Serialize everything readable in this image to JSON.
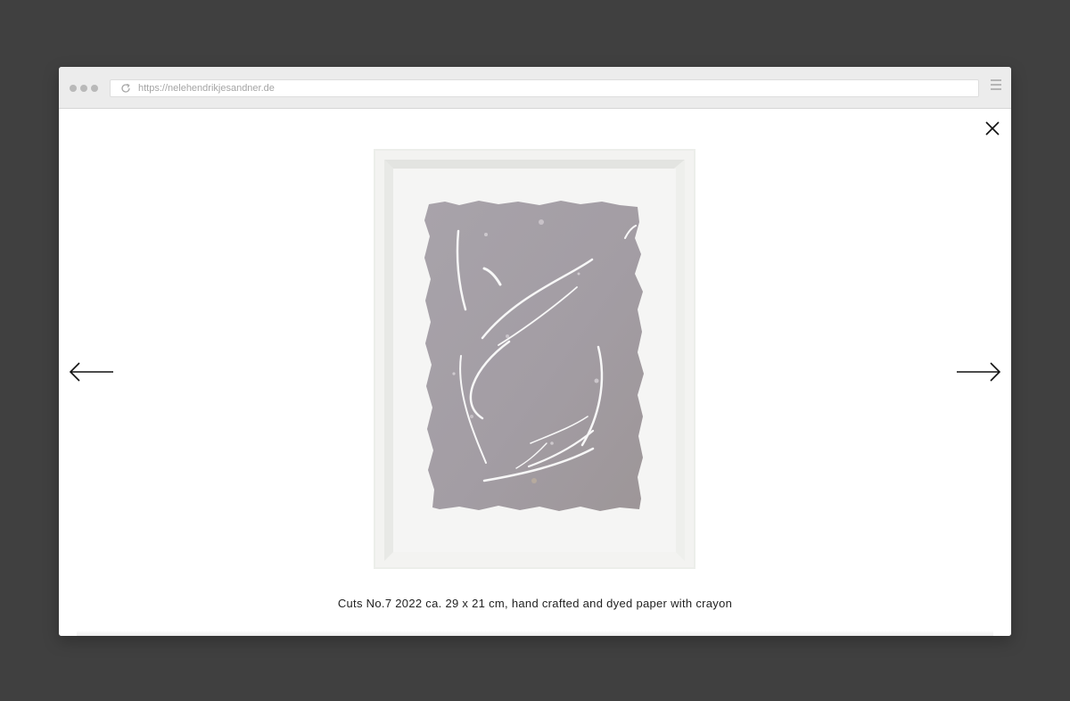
{
  "browser": {
    "url": "https://nelehendrikjesandner.de",
    "window_controls": [
      "dot",
      "dot",
      "dot"
    ],
    "icons": {
      "reload": "reload-icon",
      "menu": "hamburger-menu-icon"
    }
  },
  "lightbox": {
    "caption": "Cuts No.7 2022 ca. 29 x 21 cm, hand crafted and dyed paper with crayon",
    "icons": {
      "close": "close-icon",
      "previous": "arrow-left-icon",
      "next": "arrow-right-icon"
    },
    "colors": {
      "background": "#404040",
      "frame": "#f2f2f0",
      "paper": "#a59fa6",
      "cuts": "#f7f7f7"
    }
  }
}
